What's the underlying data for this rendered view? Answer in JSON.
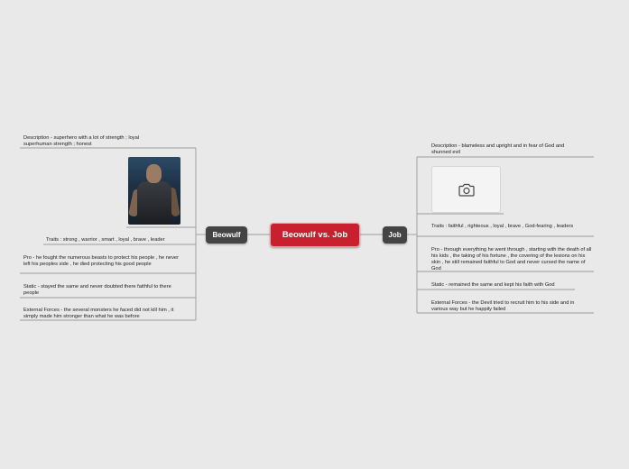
{
  "center": {
    "label": "Beowulf vs. Job"
  },
  "left": {
    "label": "Beowulf",
    "items": [
      {
        "key": "description",
        "text": "Description - superhero with a lot of strength ; loyal superhuman strength ; honest"
      },
      {
        "key": "traits",
        "text": "Traits : strong , warrior , smart , loyal , brave , leader"
      },
      {
        "key": "pro",
        "text": "Pro -  he fought the numerous beasts to protect his people , he never left his peoples side , he died protecting his good people"
      },
      {
        "key": "static",
        "text": "Static - stayed the same and never doubted there faithful to there people"
      },
      {
        "key": "external",
        "text": "External Forces - the  several monsters he faced did not kill him , it simply made him stronger than what he was before"
      }
    ]
  },
  "right": {
    "label": "Job",
    "items": [
      {
        "key": "description",
        "text": "Description - blameless and upright and in fear of God and shunned evil"
      },
      {
        "key": "traits",
        "text": "Traits : faithful , righteous , loyal , brave , God-fearing , leaders"
      },
      {
        "key": "pro",
        "text": "Pro - through everything he went through , starting with the death of all his kids , the taking of his fortune , the covering of the lesions on his skin , he still remained faithful to God and never cursed the name of God"
      },
      {
        "key": "static",
        "text": "Static - remained the same and kept his faith with God"
      },
      {
        "key": "external",
        "text": "External Forces - the Devil tried to recruit him to his side and in various way but he happily failed"
      }
    ]
  },
  "icons": {
    "image_placeholder": "camera-icon",
    "photo": "warrior-photo"
  },
  "colors": {
    "center": "#c8202e",
    "side": "#444444",
    "background": "#e9e9e9",
    "lines": "#9a9a9a"
  }
}
